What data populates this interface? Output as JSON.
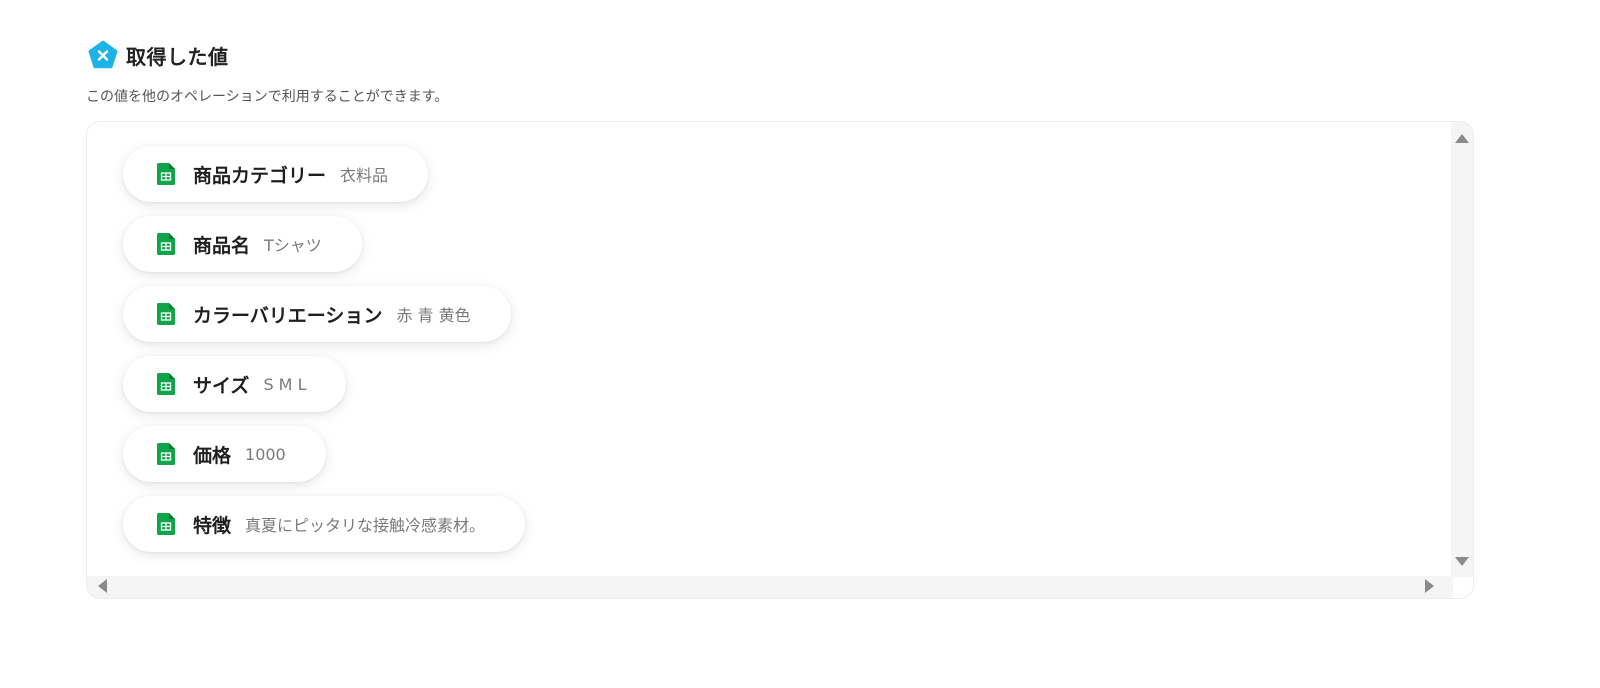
{
  "header": {
    "icon": "variable-pentagon-icon",
    "icon_color": "#1cb3e6",
    "title": "取得した値",
    "description": "この値を他のオペレーションで利用することができます。"
  },
  "values": {
    "icon": "google-sheets-icon",
    "icon_color": "#11a44b",
    "items": [
      {
        "label": "商品カテゴリー",
        "value": "衣料品"
      },
      {
        "label": "商品名",
        "value": "Tシャツ"
      },
      {
        "label": "カラーバリエーション",
        "value": "赤 青 黄色"
      },
      {
        "label": "サイズ",
        "value": "S M L"
      },
      {
        "label": "価格",
        "value": "1000"
      },
      {
        "label": "特徴",
        "value": "真夏にピッタリな接触冷感素材。"
      }
    ]
  }
}
